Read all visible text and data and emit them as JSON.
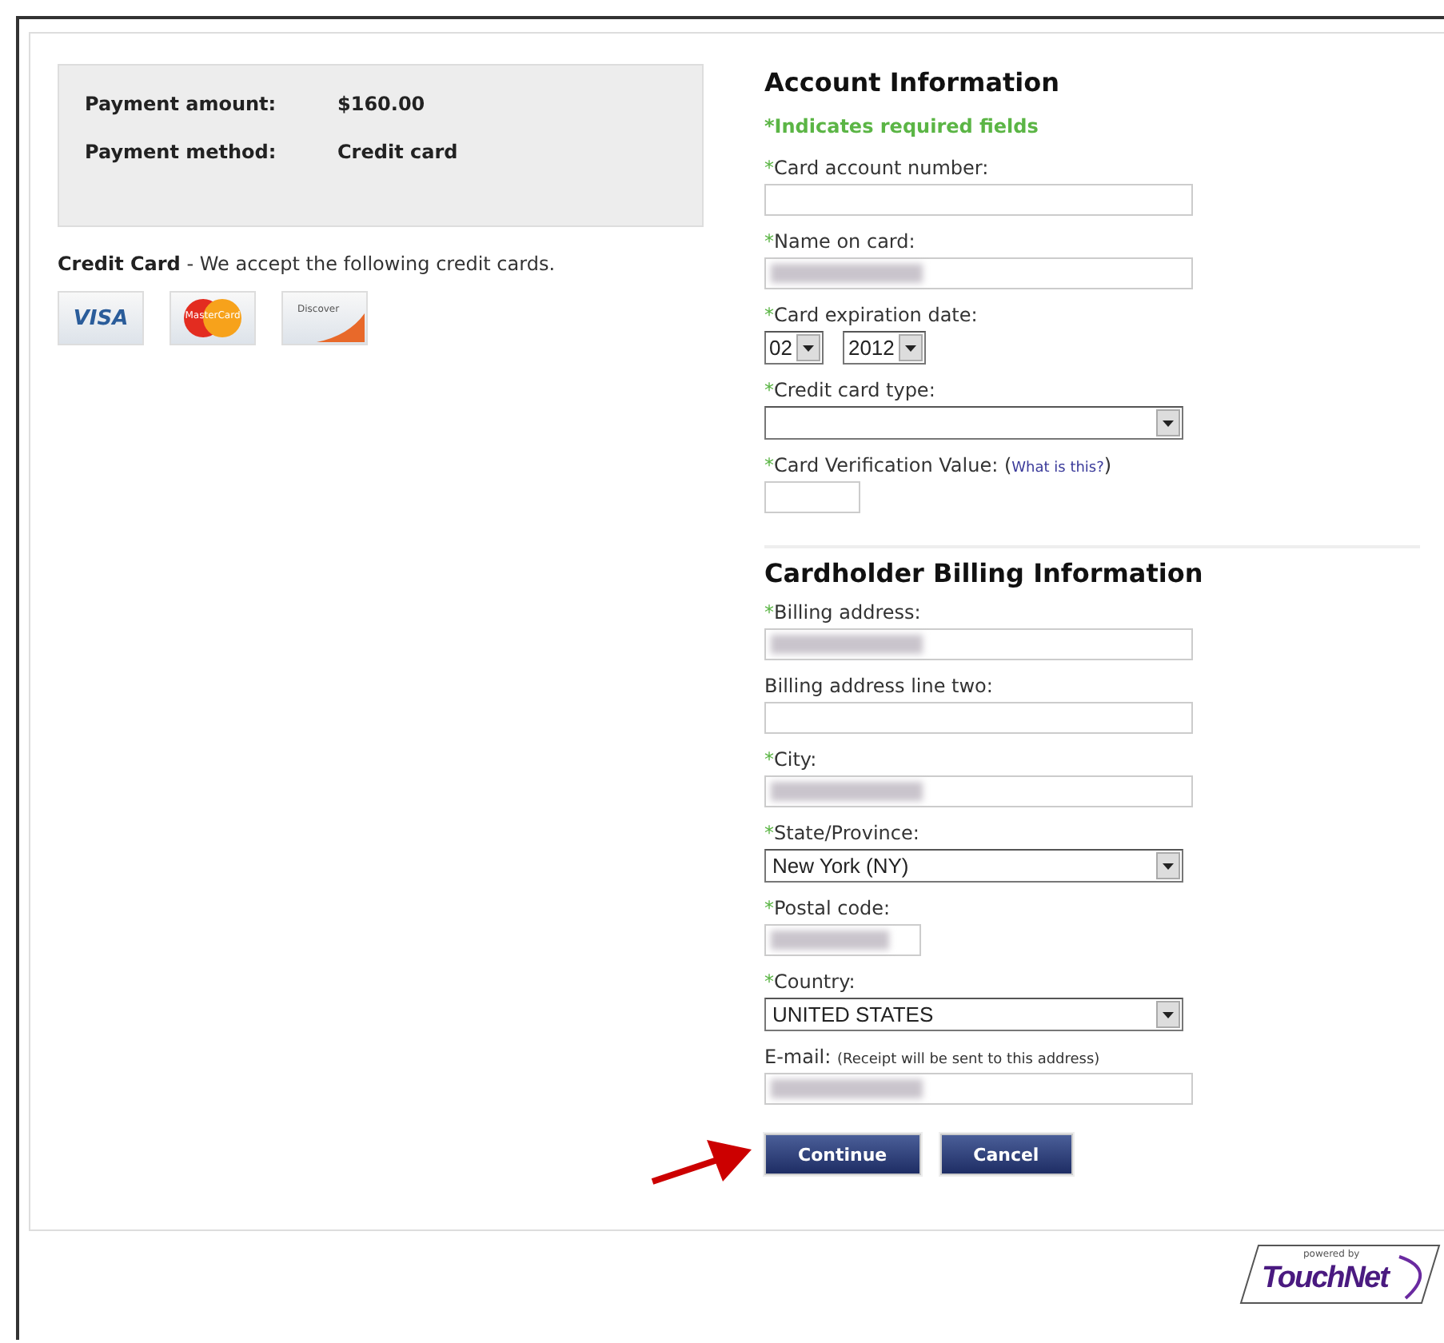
{
  "summary": {
    "rows": [
      {
        "label": "Payment amount:",
        "value": "$160.00"
      },
      {
        "label": "Payment method:",
        "value": "Credit card"
      }
    ]
  },
  "cards_note": {
    "title": "Credit Card",
    "text": " - We accept the following credit cards."
  },
  "card_logos": [
    {
      "kind": "visa",
      "text": "VISA"
    },
    {
      "kind": "mastercard",
      "text": "MasterCard"
    },
    {
      "kind": "discover",
      "text": "Discover"
    }
  ],
  "sections": [
    {
      "title": "Account Information",
      "note": "*Indicates required fields",
      "divider": false,
      "fields": [
        {
          "kind": "text",
          "marker": "*",
          "label": "Card account number:",
          "redacted": false
        },
        {
          "kind": "text",
          "marker": "*",
          "label": "Name on card:",
          "redacted": true
        },
        {
          "kind": "date",
          "marker": "*",
          "label": "Card expiration date:",
          "month": "02",
          "year": "2012"
        },
        {
          "kind": "select",
          "marker": "*",
          "label": "Credit card type:"
        },
        {
          "kind": "short",
          "marker": "*",
          "label": "Card Verification Value:",
          "link": {
            "before": "(",
            "text": "What is this?",
            "after": ")"
          },
          "redacted": false
        }
      ]
    },
    {
      "title": "Cardholder Billing Information",
      "divider": true,
      "fields": [
        {
          "kind": "text",
          "marker": "*",
          "label": "Billing address:",
          "redacted": true
        },
        {
          "kind": "text",
          "label": "Billing address line two:",
          "redacted": false
        },
        {
          "kind": "text",
          "marker": "*",
          "label": "City:",
          "redacted": true
        },
        {
          "kind": "select",
          "marker": "*",
          "label": "State/Province:",
          "value": "New York (NY)"
        },
        {
          "kind": "short",
          "marker": "*",
          "label": "Postal code:",
          "redacted": true
        },
        {
          "kind": "select",
          "marker": "*",
          "label": "Country:",
          "value": "UNITED STATES"
        },
        {
          "kind": "text",
          "label": "E-mail:",
          "hint": "(Receipt will be sent to this address)",
          "redacted": true
        }
      ]
    }
  ],
  "buttons": [
    "Continue",
    "Cancel"
  ],
  "footer_logo": {
    "tagline": "powered by",
    "name": "TouchNet"
  }
}
